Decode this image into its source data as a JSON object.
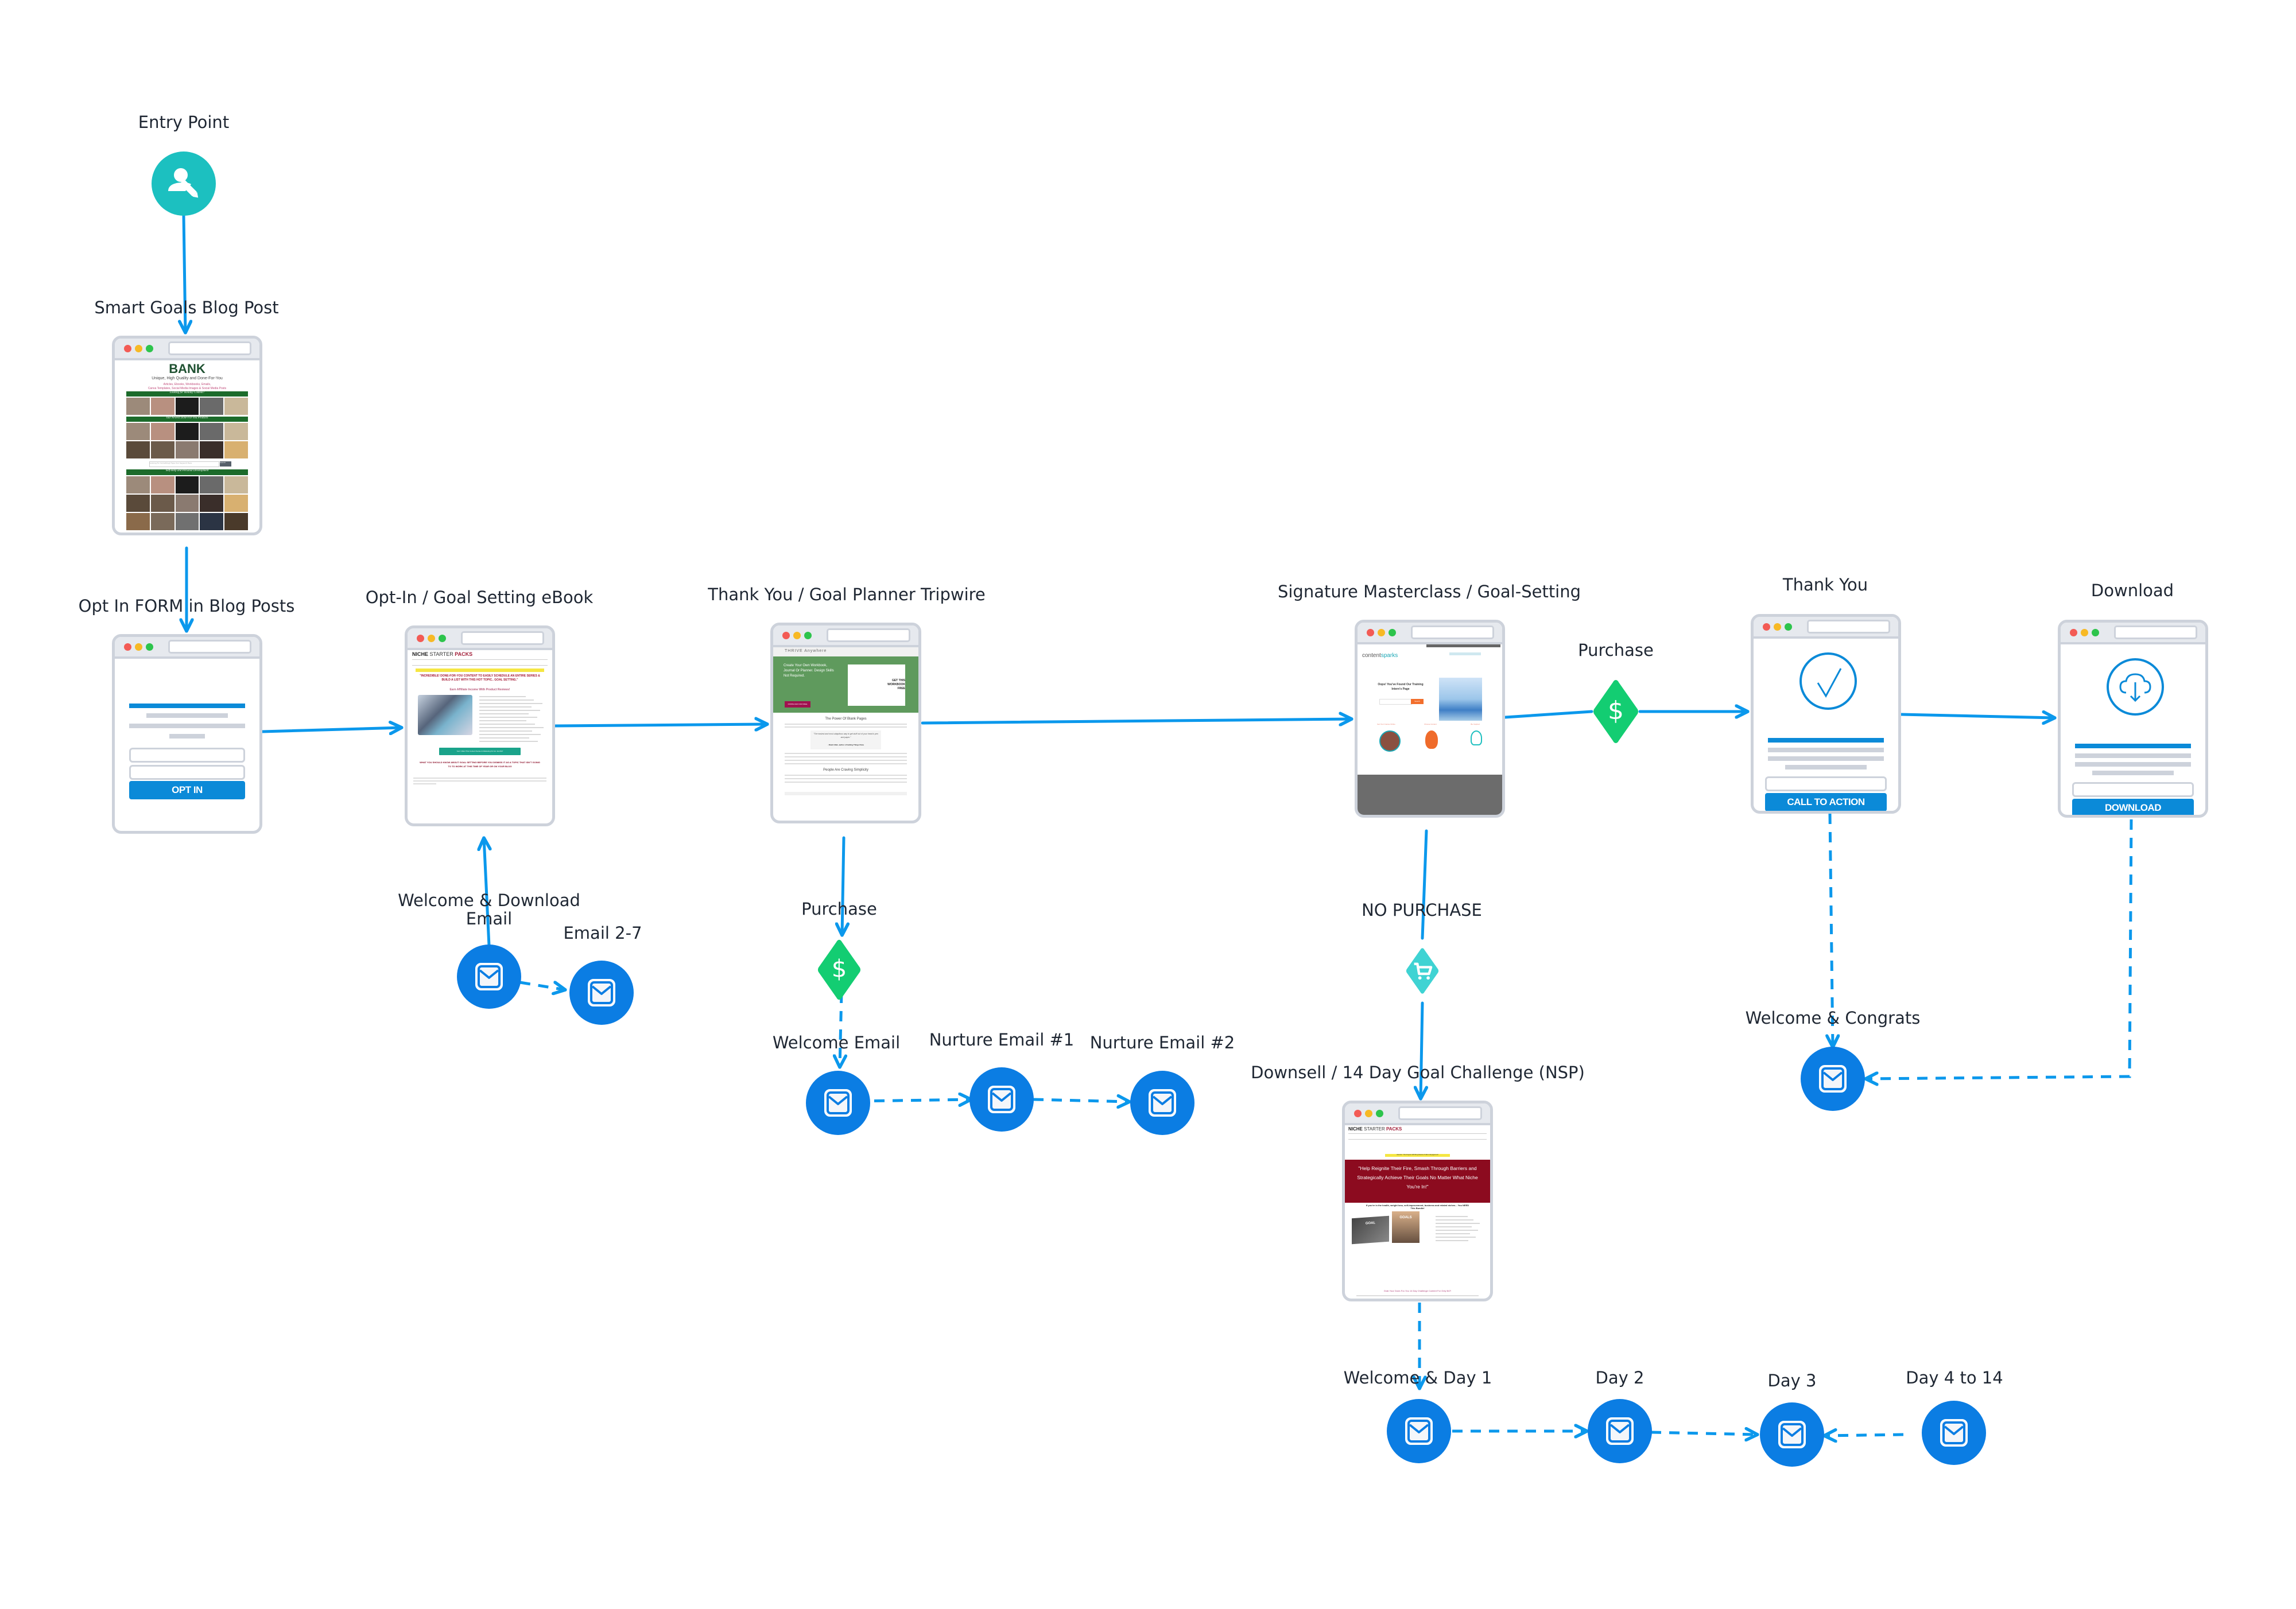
{
  "colors": {
    "connector": "#0b98ec",
    "email_node": "#0b7de3",
    "entry_node": "#1cc0c0",
    "purchase_diamond": "#13cd72",
    "no_purchase_diamond": "#3fd3d3",
    "browser_border": "#cdd2db",
    "cta_blue": "#0b8ad8"
  },
  "nodes": {
    "entry": {
      "label": "Entry Point",
      "icon": "user-edit-icon"
    },
    "blog_post": {
      "label": "Smart Goals Blog Post",
      "thumb": {
        "brand": "BANK",
        "tagline": "Unique, High Quality and Done-For-You",
        "sub1": "Articles, Ebooks, Workbooks, Emails,",
        "sub2": "Canva Templates, Social Media Images & Social Media Posts",
        "banner1": "Looking for Holiday Content?",
        "banner2": "Our Newest Done-For-You Products",
        "banner3": "Self-Help and Personal Development",
        "search_placeholder": "Looking For Something? Type Your Keyword Here",
        "search_button": "Search"
      }
    },
    "optin_form": {
      "label": "Opt In FORM in Blog Posts",
      "button": "OPT IN"
    },
    "ebook": {
      "label": "Opt-In / Goal Setting eBook",
      "thumb": {
        "brand_a": "NICHE",
        "brand_b": "STARTER",
        "brand_c": "PACKS",
        "headline": "\"INCREDIBLE! DONE-FOR-YOU CONTENT TO EASILY SCHEDULE AN ENTIRE SERIES & BUILD A LIST WITH THIS HOT TOPIC.. GOAL SETTING.\"",
        "subhead": "Earn Affiliate Income With Product Reviews!",
        "cta": "Yes! I Want This Content Series & Marketing Kit For Just $17",
        "headline2": "WHAT YOU SHOULD KNOW ABOUT GOAL SETTING BEFORE YOU DISMISS IT AS A TOPIC THAT ISN'T GOING TO TO WORK AT THIS TIME OF YEAR OR ON YOUR BLOG"
      }
    },
    "tripwire": {
      "label": "Thank You / Goal Planner Tripwire",
      "thumb": {
        "brand": "THRIVE Anywhere",
        "hero": "Create Your Own Workbook, Journal Or Planner. Design Skills Not Required.",
        "badge": "GET THIS WORKBOOK FREE",
        "button": "DOWNLOAD FOR FREE",
        "h1": "The Power Of Blank Pages",
        "quote": "\"The easiest and most ubiquitous way to get stuff out of your head is pen and paper.\"",
        "quote_author": "- David Allen, author of Getting Things Done",
        "h2": "People Are Craving Simplicity"
      }
    },
    "masterclass": {
      "label": "Signature Masterclass / Goal-Setting",
      "thumb": {
        "brand_a": "content",
        "brand_b": "sparks",
        "hero": "Oops! You've Found Our Training Intern's Page",
        "search_button": "Search",
        "col1": "Get Your Course Online",
        "col2": "Choose Content",
        "col3": "Be Inspired"
      }
    },
    "purchase_main": {
      "label": "Purchase",
      "icon": "dollar-icon"
    },
    "thank_you": {
      "label": "Thank You",
      "button": "CALL TO ACTION",
      "icon": "check-circle-icon"
    },
    "download": {
      "label": "Download",
      "button": "DOWNLOAD",
      "icon": "cloud-download-icon"
    },
    "purchase_tripwire": {
      "label": "Purchase",
      "icon": "dollar-icon"
    },
    "no_purchase": {
      "label": "NO PURCHASE",
      "icon": "cart-icon"
    },
    "downsell": {
      "label": "Downsell / 14 Day Goal Challenge (NSP)",
      "thumb": {
        "brand_a": "NICHE",
        "brand_b": "STARTER",
        "brand_c": "PACKS",
        "attention": "Attention: This Program Will Bring Massive Traffic & Engagement!",
        "hero": "\"Help Reignite Their Fire, Smash Through Barriers and Strategically Achieve Their Goals No Matter What Niche You're In!\"",
        "sub": "If you're in the health, weight loss, self-improvement, business and related niches... You NEED This Bundle!",
        "book1": "GOAL",
        "book2": "GOALS",
        "footer": "Grab Your Done-For-You 14 Day Challenge Content For Only $47!"
      }
    },
    "emails": {
      "welcome_download": "Welcome & Download Email",
      "email_2_7": "Email 2-7",
      "welcome_email": "Welcome Email",
      "nurture_1": "Nurture Email #1",
      "nurture_2": "Nurture Email #2",
      "welcome_congrats": "Welcome & Congrats",
      "day_1": "Welcome & Day 1",
      "day_2": "Day 2",
      "day_3": "Day 3",
      "day_4_14": "Day 4 to 14"
    }
  }
}
